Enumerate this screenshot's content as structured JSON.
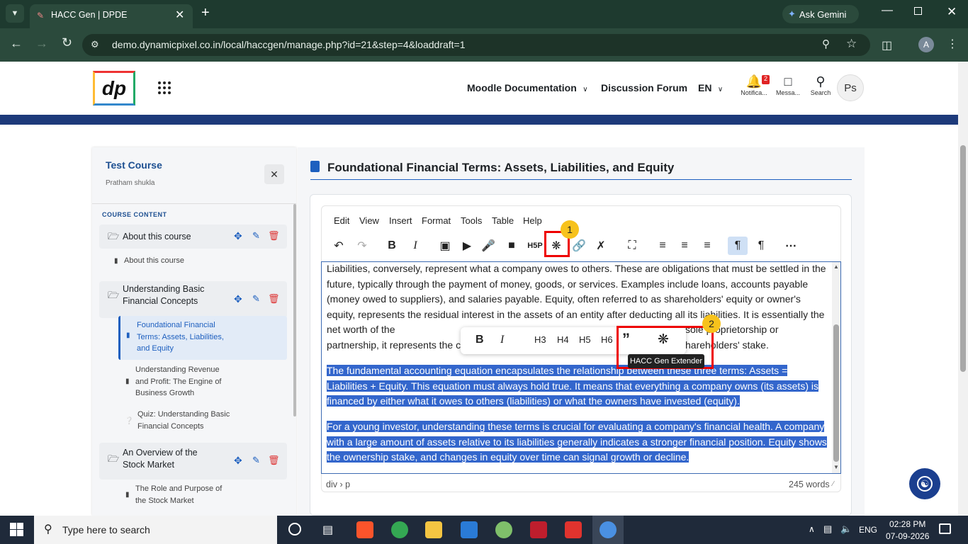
{
  "browser": {
    "tab_title": "HACC Gen | DPDE",
    "gemini_label": "Ask Gemini",
    "url": "demo.dynamicpixel.co.in/local/haccgen/manage.php?id=21&step=4&loaddraft=1",
    "profile_initial": "A"
  },
  "header": {
    "logo_text": "dp",
    "nav_docs": "Moodle Documentation",
    "nav_forum": "Discussion Forum",
    "lang": "EN",
    "notif_label": "Notifica...",
    "notif_count": "2",
    "msg_label": "Messa...",
    "search_label": "Search",
    "avatar_initials": "Ps"
  },
  "sidebar": {
    "course_title": "Test Course",
    "author": "Pratham shukla",
    "content_heading": "COURSE CONTENT",
    "sections": [
      {
        "title": "About this course",
        "items": [
          "About this course"
        ]
      },
      {
        "title": "Understanding Basic Financial Concepts",
        "items": [
          "Foundational Financial Terms: Assets, Liabilities, and Equity",
          "Understanding Revenue and Profit: The Engine of Business Growth",
          "Quiz: Understanding Basic Financial Concepts"
        ]
      },
      {
        "title": "An Overview of the Stock Market",
        "items": [
          "The Role and Purpose of the Stock Market"
        ]
      }
    ]
  },
  "main": {
    "page_title": "Foundational Financial Terms: Assets, Liabilities, and Equity",
    "menus": [
      "Edit",
      "View",
      "Insert",
      "Format",
      "Tools",
      "Table",
      "Help"
    ],
    "paragraphs": [
      "Liabilities, conversely, represent what a company owes to others. These are obligations that must be settled in the future, typically through the payment of money, goods, or services. Examples include loans, accounts payable (money owed to suppliers), and salaries payable. Equity, often referred to as shareholders' equity or owner's equity, represents the residual interest in the assets of an entity after deducting all its liabilities. It is essentially the net worth of the",
      "sole proprietorship or",
      "partnership, it represents the c",
      "hareholders' stake.",
      "The fundamental accounting equation encapsulates the relationship between these three terms: Assets = Liabilities + Equity. This equation must always hold true. It means that everything a company owns (its assets) is financed by either what it owes to others (liabilities) or what the owners have invested (equity).",
      "For a young investor, understanding these terms is crucial for evaluating a company's financial health. A company with a large amount of assets relative to its liabilities generally indicates a stronger financial position. Equity shows the ownership stake, and changes in equity over time can signal growth or decline."
    ],
    "quickbar": {
      "bold": "B",
      "italic": "I",
      "h3": "H3",
      "h4": "H4",
      "h5": "H5",
      "h6": "H6"
    },
    "tooltip": "HACC Gen Extender",
    "badge1": "1",
    "badge2": "2",
    "status_path": "div › p",
    "word_count": "245 words"
  },
  "taskbar": {
    "search_placeholder": "Type here to search",
    "lang": "ENG",
    "time": "02:28 PM",
    "date": "07-09-2026"
  }
}
